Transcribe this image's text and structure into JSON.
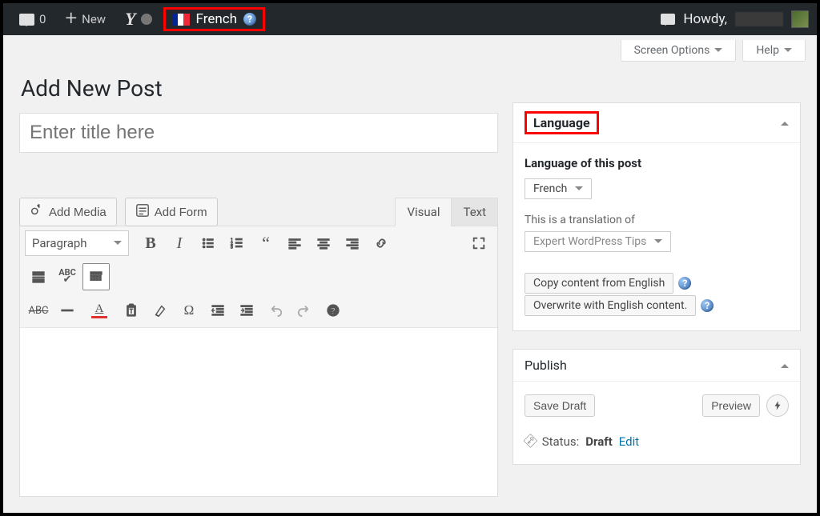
{
  "adminbar": {
    "comments_count": "0",
    "new_label": "New",
    "language_label": "French",
    "howdy_prefix": "Howdy,"
  },
  "screen_meta": {
    "screen_options": "Screen Options",
    "help": "Help"
  },
  "page": {
    "heading": "Add New Post",
    "title_placeholder": "Enter title here"
  },
  "media": {
    "add_media": "Add Media",
    "add_form": "Add Form"
  },
  "editor_tabs": {
    "visual": "Visual",
    "text": "Text"
  },
  "toolbar": {
    "format_label": "Paragraph"
  },
  "language_box": {
    "title": "Language",
    "subtitle": "Language of this post",
    "selected": "French",
    "translation_of_label": "This is a translation of",
    "translation_of_value": "Expert WordPress Tips",
    "copy_btn": "Copy content from English",
    "overwrite_btn": "Overwrite with English content."
  },
  "publish_box": {
    "title": "Publish",
    "save_draft": "Save Draft",
    "preview": "Preview",
    "status_label": "Status:",
    "status_value": "Draft",
    "edit_link": "Edit"
  }
}
